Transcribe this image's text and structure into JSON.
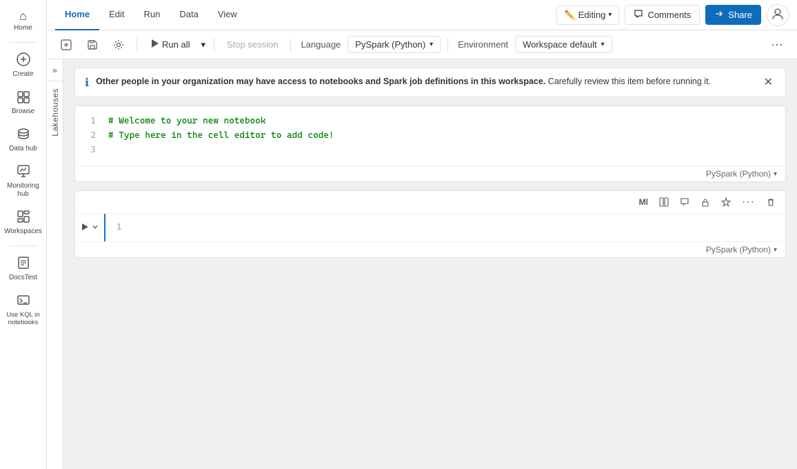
{
  "sidebar": {
    "items": [
      {
        "id": "home",
        "label": "Home",
        "icon": "⌂",
        "active": false
      },
      {
        "id": "create",
        "label": "Create",
        "icon": "+",
        "active": false
      },
      {
        "id": "browse",
        "label": "Browse",
        "icon": "⊞",
        "active": false
      },
      {
        "id": "datahub",
        "label": "Data hub",
        "icon": "🗄",
        "active": false
      },
      {
        "id": "monitoring",
        "label": "Monitoring hub",
        "icon": "📊",
        "active": false
      },
      {
        "id": "workspaces",
        "label": "Workspaces",
        "icon": "◫",
        "active": false
      },
      {
        "id": "docstest",
        "label": "DocsTest",
        "icon": "📋",
        "active": false
      },
      {
        "id": "kql",
        "label": "Use KQL in notebooks",
        "icon": "⊡",
        "active": false
      }
    ]
  },
  "topnav": {
    "tabs": [
      {
        "id": "home",
        "label": "Home",
        "active": true
      },
      {
        "id": "edit",
        "label": "Edit",
        "active": false
      },
      {
        "id": "run",
        "label": "Run",
        "active": false
      },
      {
        "id": "data",
        "label": "Data",
        "active": false
      },
      {
        "id": "view",
        "label": "View",
        "active": false
      }
    ],
    "editing_label": "Editing",
    "editing_chevron": "▾",
    "comments_label": "Comments",
    "share_label": "Share"
  },
  "toolbar": {
    "add_code_title": "Add code",
    "save_title": "Save",
    "settings_title": "Settings",
    "run_all_label": "Run all",
    "run_all_chevron": "▾",
    "stop_session_label": "Stop session",
    "language_label": "Language",
    "language_value": "PySpark (Python)",
    "language_chevron": "▾",
    "environment_label": "Environment",
    "environment_value": "Workspace default",
    "environment_chevron": "▾",
    "more_icon": "···"
  },
  "side_panel": {
    "collapse_icon": "»",
    "label": "Lakehouses"
  },
  "info_banner": {
    "icon": "ℹ",
    "text_bold": "Other people in your organization may have access to notebooks and Spark job definitions in this workspace.",
    "text_normal": " Carefully review this item before running it.",
    "close_icon": "✕"
  },
  "cell1": {
    "lines": [
      {
        "num": "1",
        "code": "# Welcome to your new notebook"
      },
      {
        "num": "2",
        "code": "# Type here in the cell editor to add code!"
      },
      {
        "num": "3",
        "code": ""
      }
    ],
    "lang_label": "PySpark (Python)",
    "lang_chevron": "▾"
  },
  "cell2": {
    "toolbar_buttons": [
      {
        "id": "ml",
        "icon": "Ml",
        "title": "ML"
      },
      {
        "id": "split",
        "icon": "⧉",
        "title": "Split cell"
      },
      {
        "id": "comment",
        "icon": "💬",
        "title": "Comment"
      },
      {
        "id": "lock",
        "icon": "🔒",
        "title": "Lock"
      },
      {
        "id": "sparkle",
        "icon": "✳",
        "title": "AI assist"
      },
      {
        "id": "more",
        "icon": "···",
        "title": "More"
      },
      {
        "id": "delete",
        "icon": "🗑",
        "title": "Delete"
      }
    ],
    "run_icon": "▶",
    "chevron_icon": "▾",
    "line_num": "1",
    "lang_label": "PySpark (Python)",
    "lang_chevron": "▾"
  }
}
